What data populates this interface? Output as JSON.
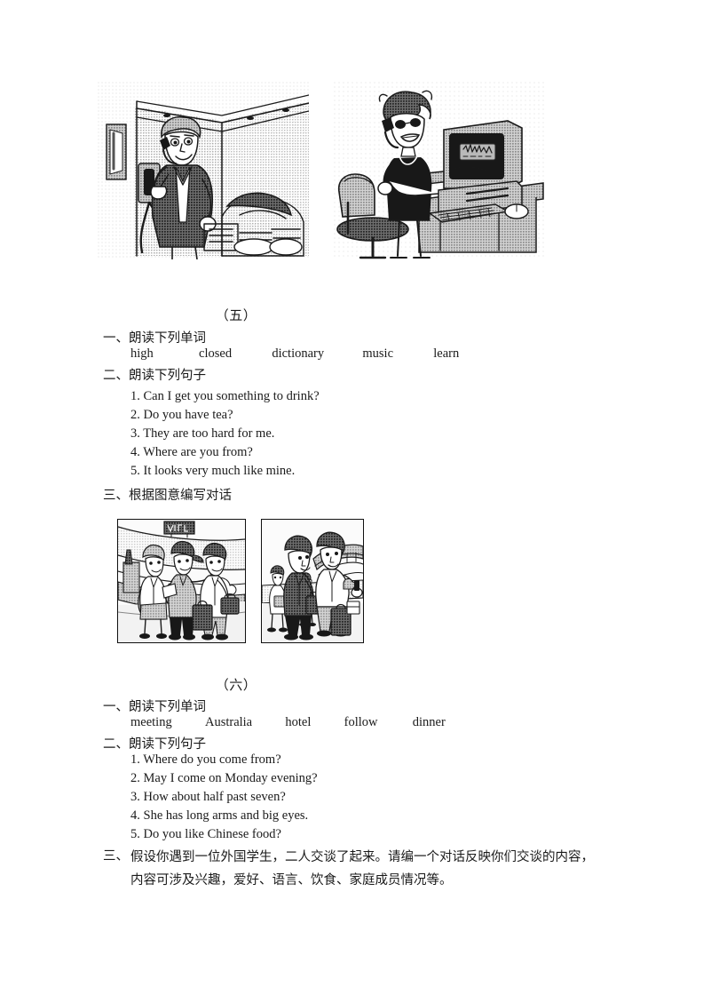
{
  "page": {
    "background": "#ffffff",
    "ink_color": "#1a1a1a"
  },
  "illustrations": {
    "top": {
      "caption_present": false,
      "panels": [
        {
          "name": "man-on-wall-phone-in-living-room",
          "description": "A man standing in a living room corner talking on a wall-mounted telephone, sofa and cushions behind him, framed picture on the left wall",
          "framed": false
        },
        {
          "name": "woman-on-phone-at-computer-desk",
          "description": "A woman standing beside a desk talking on a telephone, desktop computer with CRT monitor, keyboard and mouse on the desk, office chair at left",
          "framed": false
        }
      ]
    },
    "middle": {
      "framed": true,
      "panels": [
        {
          "name": "airport-three-people-talking",
          "description": "Three travellers with luggage talking in an airport terminal, sign board overhead"
        },
        {
          "name": "airport-two-people-talking",
          "description": "Two travellers with bags talking in an airport terminal, suitcases on the floor, curved balcony railing behind"
        }
      ]
    }
  },
  "sections": [
    {
      "id": "five",
      "title": "（五）",
      "items": [
        {
          "label": "一、朗读下列单词",
          "type": "words",
          "words": [
            "high",
            "closed",
            "dictionary",
            "music",
            "learn"
          ]
        },
        {
          "label": "二、朗读下列句子",
          "type": "sentences",
          "sentences": [
            "1. Can I get you something to drink?",
            "2. Do you have tea?",
            "3. They are too hard for me.",
            "4. Where are you from?",
            "5. It looks very much like mine."
          ]
        },
        {
          "label": "三、根据图意编写对话",
          "type": "picture-task"
        }
      ]
    },
    {
      "id": "six",
      "title": "（六）",
      "items": [
        {
          "label": "一、朗读下列单词",
          "type": "words",
          "words": [
            "meeting",
            "Australia",
            "hotel",
            "follow",
            "dinner"
          ]
        },
        {
          "label": "二、朗读下列句子",
          "type": "sentences",
          "sentences": [
            "1. Where do you come from?",
            "2. May I come on Monday evening?",
            "3. How about half past seven?",
            "4. She has long arms and big eyes.",
            "5. Do you like Chinese food?"
          ]
        },
        {
          "label": "三、",
          "type": "paragraph",
          "paragraph": "假设你遇到一位外国学生，二人交谈了起来。请编一个对话反映你们交谈的内容，内容可涉及兴趣，爱好、语言、饮食、家庭成员情况等。"
        }
      ]
    }
  ]
}
